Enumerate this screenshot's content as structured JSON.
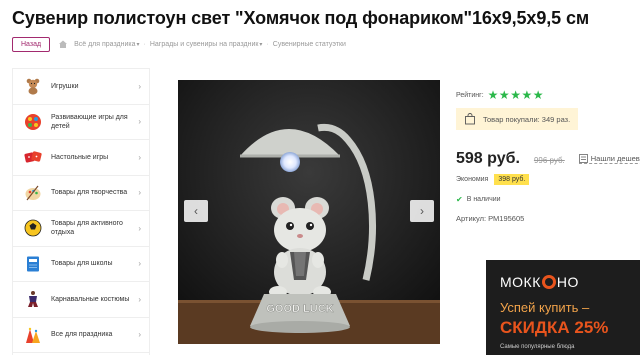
{
  "product": {
    "title": "Сувенир полистоун свет \"Хомячок под фонариком\"16х9,5х9,5 см"
  },
  "breadcrumbs": {
    "back_label": "Назад",
    "items": [
      "Всё для праздника",
      "Награды и сувениры на праздник",
      "Сувенирные статуэтки"
    ]
  },
  "sidebar": {
    "items": [
      {
        "label": "Игрушки",
        "icon": "teddy-bear-icon"
      },
      {
        "label": "Развивающие игры для детей",
        "icon": "abacus-icon"
      },
      {
        "label": "Настольные игры",
        "icon": "dice-icon"
      },
      {
        "label": "Товары для творчества",
        "icon": "palette-icon"
      },
      {
        "label": "Товары для активного отдыха",
        "icon": "ball-icon"
      },
      {
        "label": "Товары для школы",
        "icon": "notebook-icon"
      },
      {
        "label": "Карнавальные костюмы",
        "icon": "costume-icon"
      },
      {
        "label": "Все для праздника",
        "icon": "party-hat-icon"
      }
    ]
  },
  "info": {
    "rating_label": "Рейтинг:",
    "rating": 5,
    "rating_max": 5,
    "bought_text": "Товар покупали: 349 раз.",
    "price": "598 руб.",
    "old_price": "996 руб.",
    "find_cheaper": "Нашли дешевле",
    "savings_label": "Экономия",
    "savings_value": "398 руб.",
    "stock": "В наличии",
    "sku": "Артикул: РМ195605"
  },
  "ad": {
    "brand": [
      "МОКК",
      "НО"
    ],
    "line1": "Успей купить –",
    "line2": "СКИДКА 25%",
    "line3": "Самые популярные блюда"
  },
  "colors": {
    "accent": "#a22a6f",
    "star": "#2bb84a",
    "badge": "#ffe04d",
    "ad_orange": "#e8541d"
  }
}
